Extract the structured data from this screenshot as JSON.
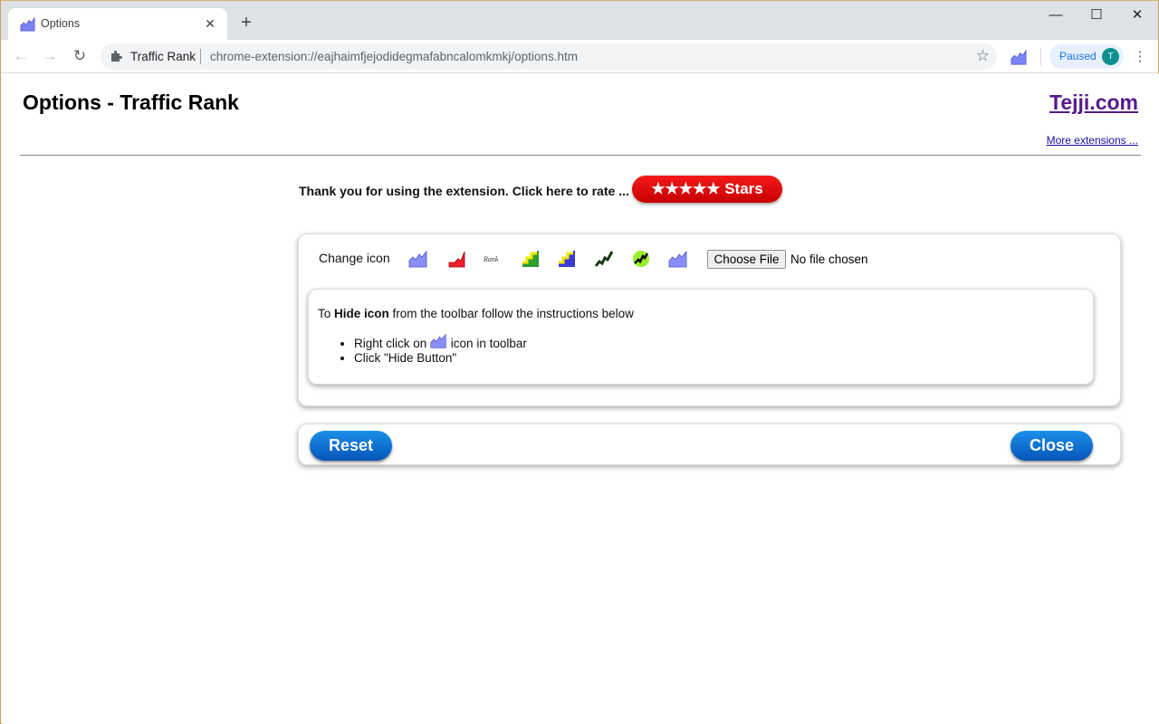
{
  "browser": {
    "tab_title": "Options",
    "tab_close": "✕",
    "new_tab": "+",
    "window_controls": {
      "minimize": "—",
      "maximize": "☐",
      "close": "✕"
    },
    "nav": {
      "back": "←",
      "forward": "→",
      "reload": "↻"
    },
    "omnibox": {
      "site_name": "Traffic Rank",
      "url": "chrome-extension://eajhaimfjejodidegmafabncalomkmkj/options.htm",
      "star": "☆"
    },
    "profile": {
      "label": "Paused",
      "avatar_letter": "T"
    },
    "menu": "⋮"
  },
  "page": {
    "title": "Options - Traffic Rank",
    "brand_link": "Tejji.com",
    "more_link": "More extensions ...",
    "rate": {
      "text": "Thank you for using the extension. Click here to rate ...",
      "button": "★★★★★ Stars"
    },
    "icon_panel": {
      "change_icon_label": "Change icon",
      "icons": [
        "area-chart-blue",
        "area-chart-red",
        "rank-text",
        "steps-yellow-green",
        "steps-yellow-blue",
        "zigzag-black",
        "zigzag-green-circle",
        "area-chart-blue-2"
      ],
      "rank_icon_text": "Rank",
      "file_button": "Choose File",
      "file_status": "No file chosen"
    },
    "hide_panel": {
      "prefix": "To ",
      "bold": "Hide icon",
      "suffix": " from the toolbar follow the instructions below",
      "item1_prefix": "Right click on ",
      "item1_suffix": " icon in toolbar",
      "item2": "Click \"Hide Button\""
    },
    "buttons": {
      "reset": "Reset",
      "close": "Close"
    }
  },
  "colors": {
    "rate_button": "#e00000",
    "blue_button": "#0a6fd6",
    "link_visited": "#551a8b",
    "link": "#1a0dab"
  }
}
